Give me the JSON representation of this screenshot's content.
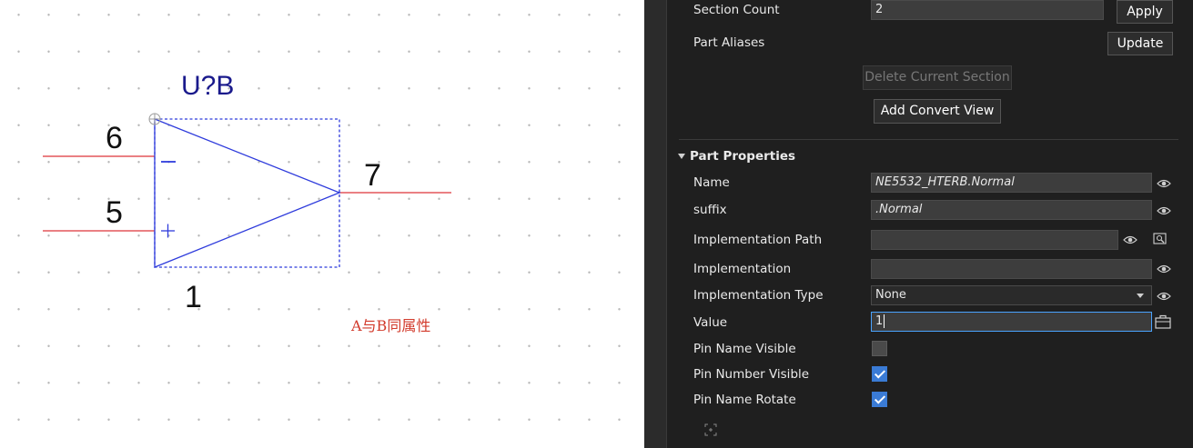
{
  "canvas": {
    "ref_designator": "U?B",
    "pins": {
      "inverting_number": "6",
      "noninverting_number": "5",
      "output_number": "7",
      "bottom_number": "1",
      "minus_symbol": "−",
      "plus_symbol": "+"
    },
    "annotation": "A与B同属性",
    "colors": {
      "wire": "#e4575a",
      "body": "#2f3cdc",
      "selection": "#2f3cdc",
      "annotation": "#d23a2b"
    }
  },
  "panel": {
    "section_count": {
      "label": "Section Count",
      "value": "2",
      "apply": "Apply"
    },
    "part_aliases": {
      "label": "Part Aliases",
      "update": "Update"
    },
    "delete_section": "Delete Current Section",
    "add_convert_view": "Add Convert View",
    "part_properties": {
      "title": "Part Properties",
      "rows": {
        "name": {
          "label": "Name",
          "value": "NE5532_HTERB.Normal"
        },
        "suffix": {
          "label": "suffix",
          "value": ".Normal"
        },
        "impl_path": {
          "label": "Implementation Path",
          "value": ""
        },
        "impl": {
          "label": "Implementation",
          "value": ""
        },
        "impl_type": {
          "label": "Implementation Type",
          "value": "None"
        },
        "value": {
          "label": "Value",
          "value": "1"
        },
        "pin_name_visible": {
          "label": "Pin Name Visible",
          "checked": false
        },
        "pin_number_visible": {
          "label": "Pin Number Visible",
          "checked": true
        },
        "pin_name_rotate": {
          "label": "Pin Name Rotate",
          "checked": true
        }
      }
    },
    "icons": [
      "eye-icon",
      "search-icon",
      "briefcase-icon",
      "expand-icon",
      "collapse-triangle-icon",
      "dropdown-arrow-icon"
    ],
    "colors": {
      "accent": "#3a7bd5",
      "background": "#1f1f1f",
      "field": "#3d3d3d"
    }
  }
}
